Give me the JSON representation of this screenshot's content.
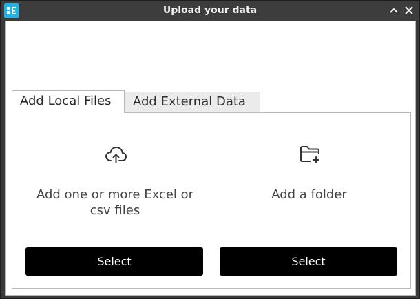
{
  "window": {
    "title": "Upload your data"
  },
  "tabs": [
    {
      "label": "Add Local Files",
      "active": true
    },
    {
      "label": "Add External Data",
      "active": false
    }
  ],
  "local_files": {
    "files": {
      "icon": "cloud-upload-icon",
      "description": "Add one or more Excel or csv files",
      "button_label": "Select"
    },
    "folder": {
      "icon": "folder-add-icon",
      "description": "Add a folder",
      "button_label": "Select"
    }
  },
  "colors": {
    "titlebar": "#3d3d3d",
    "app_icon": "#1fb3e8",
    "button": "#000000"
  }
}
